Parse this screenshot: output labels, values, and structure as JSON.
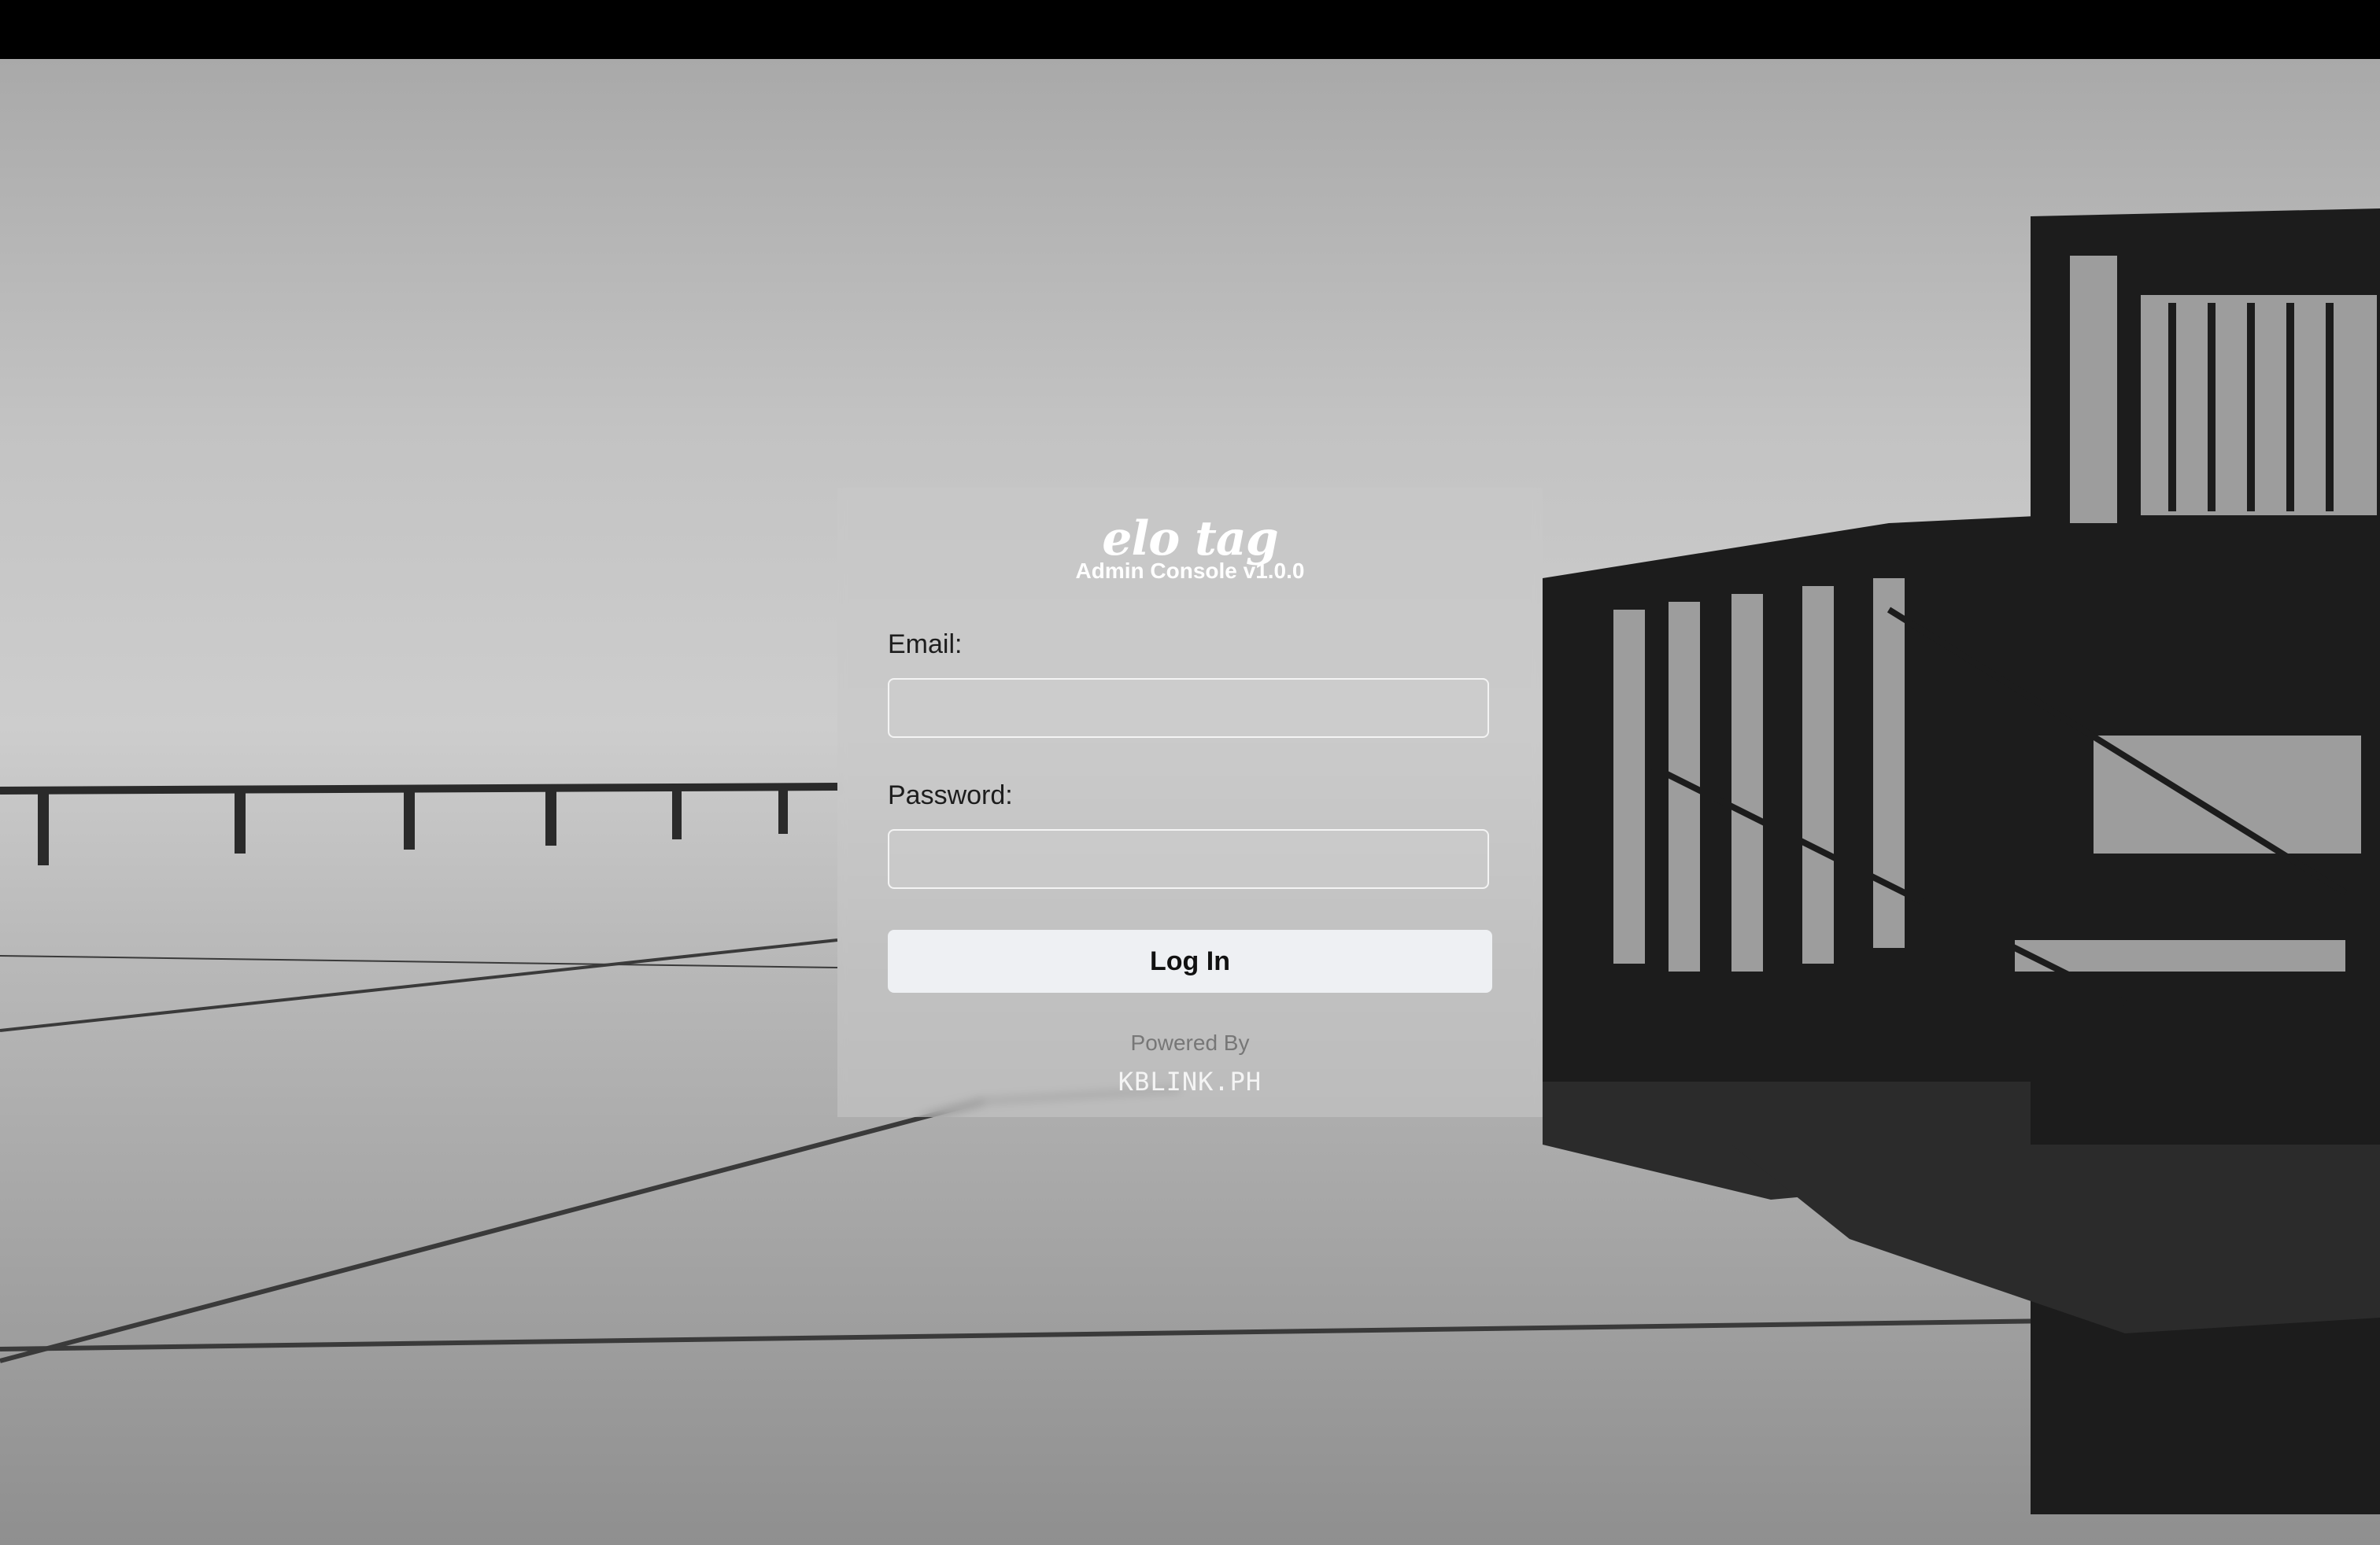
{
  "brand": {
    "logo_text": "elo tag",
    "subtitle": "Admin Console v1.0.0"
  },
  "form": {
    "email_label": "Email:",
    "email_value": "",
    "password_label": "Password:",
    "password_value": "",
    "login_label": "Log In"
  },
  "footer": {
    "powered_by": "Powered By",
    "company": "KBLINK.PH"
  },
  "colors": {
    "button_bg": "#eef0f3",
    "logo_text": "#ffffff"
  }
}
